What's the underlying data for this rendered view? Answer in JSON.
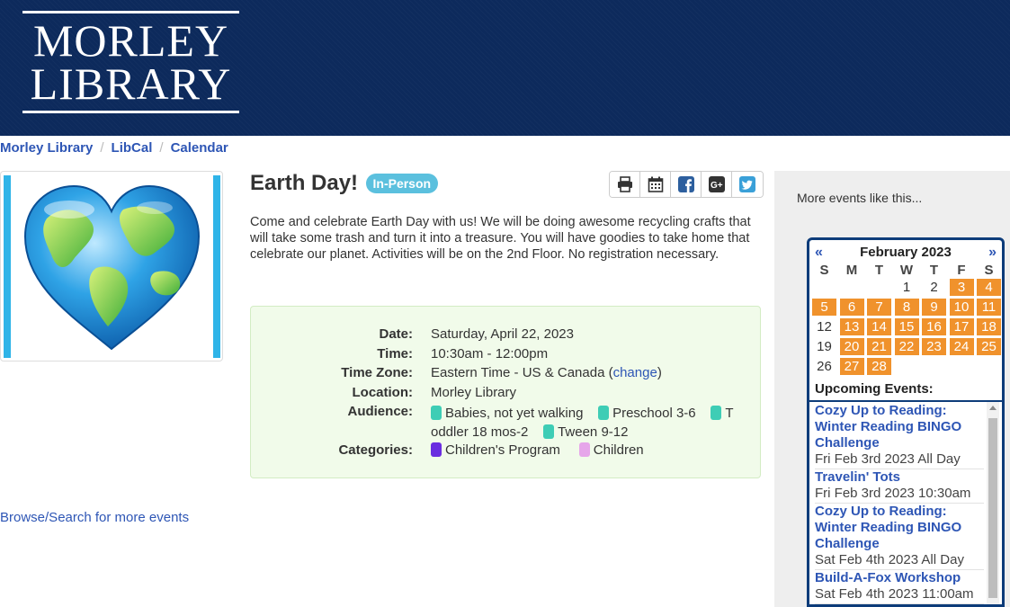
{
  "header": {
    "logo_line1": "MORLEY",
    "logo_line2": "LIBRARY",
    "bg_color": "#0d2a5c"
  },
  "breadcrumb": [
    "Morley Library",
    "LibCal",
    "Calendar"
  ],
  "event": {
    "title": "Earth Day!",
    "badge": "In-Person",
    "description": "Come and celebrate Earth Day with us!  We will be doing awesome recycling crafts that will take some trash and turn it into a treasure.  You will have goodies to take home that celebrate our planet.  Activities will be on the 2nd Floor.  No registration necessary.",
    "share_icons": [
      "print-icon",
      "calendar-icon",
      "facebook-icon",
      "google-plus-icon",
      "twitter-icon"
    ]
  },
  "details": {
    "date_label": "Date:",
    "date": "Saturday, April 22, 2023",
    "time_label": "Time:",
    "time": "10:30am - 12:00pm",
    "tz_label": "Time Zone:",
    "tz": "Eastern Time - US & Canada",
    "tz_link": "change",
    "location_label": "Location:",
    "location": "Morley Library",
    "audience_label": "Audience:",
    "audience_1": "Babies, not yet walking",
    "audience_2": "Preschool 3-6",
    "audience_3_start": "T",
    "audience_3_end": "oddler 18 mos-2",
    "audience_4": "Tween 9-12",
    "audience_color": "#3ecdb5",
    "categories_label": "Categories:",
    "category_1": "Children's Program",
    "category_1_color": "#6a2de0",
    "category_2": "Children",
    "category_2_color": "#e6a6ea"
  },
  "browse_link": "Browse/Search for more events",
  "sidebar": {
    "more_text": "More events like this...",
    "calendar": {
      "prev": "«",
      "next": "»",
      "month": "February 2023",
      "dow": [
        "S",
        "M",
        "T",
        "W",
        "T",
        "F",
        "S"
      ],
      "weeks": [
        [
          "",
          "",
          "",
          "1",
          "2",
          "3",
          "4"
        ],
        [
          "5",
          "6",
          "7",
          "8",
          "9",
          "10",
          "11"
        ],
        [
          "12",
          "13",
          "14",
          "15",
          "16",
          "17",
          "18"
        ],
        [
          "19",
          "20",
          "21",
          "22",
          "23",
          "24",
          "25"
        ],
        [
          "26",
          "27",
          "28",
          "",
          "",
          "",
          ""
        ]
      ],
      "event_days": [
        "3",
        "4",
        "5",
        "6",
        "7",
        "8",
        "9",
        "10",
        "11",
        "13",
        "14",
        "15",
        "16",
        "17",
        "18",
        "20",
        "21",
        "22",
        "23",
        "24",
        "25",
        "27",
        "28"
      ],
      "event_color": "#f0922c"
    },
    "upcoming_title": "Upcoming Events:",
    "upcoming": [
      {
        "title": "Cozy Up to Reading: Winter Reading BINGO Challenge",
        "date": "Fri Feb 3rd 2023 All Day"
      },
      {
        "title": "Travelin' Tots",
        "date": "Fri Feb 3rd 2023 10:30am"
      },
      {
        "title": "Cozy Up to Reading: Winter Reading BINGO Challenge",
        "date": "Sat Feb 4th 2023 All Day"
      },
      {
        "title": "Build-A-Fox Workshop",
        "date": "Sat Feb 4th 2023 11:00am"
      }
    ]
  }
}
